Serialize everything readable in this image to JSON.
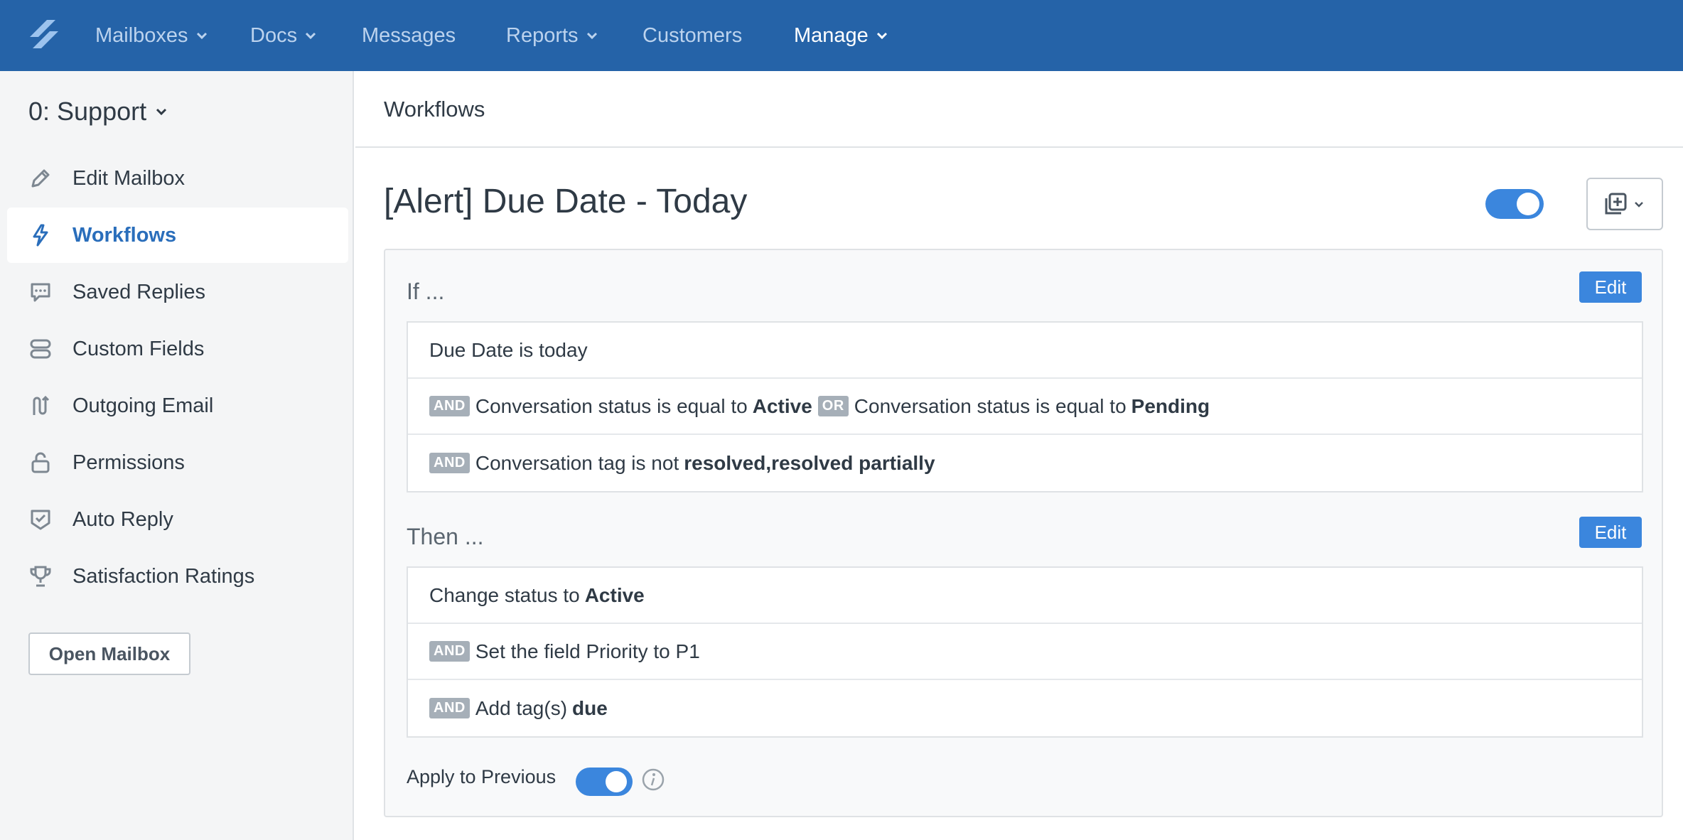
{
  "topnav": {
    "items": [
      {
        "label": "Mailboxes",
        "dropdown": true
      },
      {
        "label": "Docs",
        "dropdown": true
      },
      {
        "label": "Messages",
        "dropdown": false
      },
      {
        "label": "Reports",
        "dropdown": true
      },
      {
        "label": "Customers",
        "dropdown": false
      },
      {
        "label": "Manage",
        "dropdown": true,
        "active": true
      }
    ]
  },
  "sidebar": {
    "mailbox_title": "0: Support",
    "items": [
      {
        "label": "Edit Mailbox",
        "icon": "pencil-icon"
      },
      {
        "label": "Workflows",
        "icon": "bolt-icon",
        "active": true
      },
      {
        "label": "Saved Replies",
        "icon": "chat-bubble-icon"
      },
      {
        "label": "Custom Fields",
        "icon": "fields-icon"
      },
      {
        "label": "Outgoing Email",
        "icon": "route-icon"
      },
      {
        "label": "Permissions",
        "icon": "lock-icon"
      },
      {
        "label": "Auto Reply",
        "icon": "shield-check-icon"
      },
      {
        "label": "Satisfaction Ratings",
        "icon": "trophy-icon"
      }
    ],
    "open_mailbox_label": "Open Mailbox"
  },
  "main": {
    "page_title": "Workflows",
    "workflow_title": "[Alert] Due Date - Today",
    "workflow_enabled": true,
    "if_label": "If ...",
    "then_label": "Then ...",
    "edit_label": "Edit",
    "conditions": [
      {
        "text": "Due Date is today"
      },
      {
        "badge": "AND",
        "text": "Conversation status is equal to",
        "value": "Active",
        "or_badge": "OR",
        "text2": "Conversation status is equal to",
        "value2": "Pending"
      },
      {
        "badge": "AND",
        "text": "Conversation tag is not",
        "value": "resolved,resolved partially"
      }
    ],
    "actions": [
      {
        "text": "Change status to",
        "value": "Active"
      },
      {
        "badge": "AND",
        "text": "Set the field Priority to P1"
      },
      {
        "badge": "AND",
        "text": "Add tag(s)",
        "value": "due"
      }
    ],
    "apply_previous_label": "Apply to Previous",
    "apply_previous_enabled": true
  },
  "colors": {
    "nav_bg": "#2563a8",
    "accent": "#3b86dd",
    "active_link": "#2a6ebb"
  }
}
